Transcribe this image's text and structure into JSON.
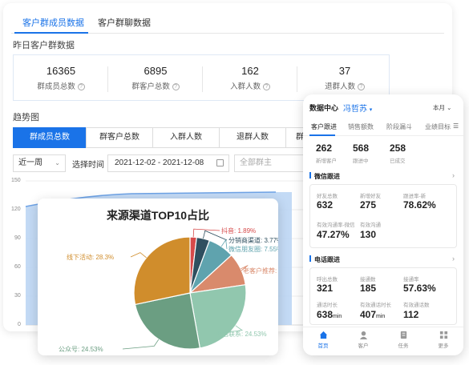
{
  "tabs": [
    "客户群成员数据",
    "客户群聊数据"
  ],
  "yesterday_title": "昨日客户群数据",
  "stats": [
    {
      "value": "16365",
      "label": "群成员总数"
    },
    {
      "value": "6895",
      "label": "群客户总数"
    },
    {
      "value": "162",
      "label": "入群人数"
    },
    {
      "value": "37",
      "label": "退群人数"
    }
  ],
  "trend_title": "趋势图",
  "metric_tabs": [
    "群成员总数",
    "群客户总数",
    "入群人数",
    "退群人数",
    "群"
  ],
  "filters": {
    "period": "近一周",
    "time_label": "选择时间",
    "date_range": "2021-12-02 - 2021-12-08",
    "owner_placeholder": "全部群主"
  },
  "trend_axis": {
    "y_ticks": [
      "150",
      "120",
      "90",
      "60",
      "30",
      "0"
    ]
  },
  "pie": {
    "title": "来源渠道TOP10占比",
    "chart_data": {
      "type": "pie",
      "slices": [
        {
          "label": "抖音",
          "value": 1.89,
          "text": "抖音: 1.89%",
          "color": "#d64a4a"
        },
        {
          "label": "分销商渠道",
          "value": 3.77,
          "text": "分销商渠道: 3.77%",
          "color": "#2f4f5f"
        },
        {
          "label": "微信朋友圈",
          "value": 7.55,
          "text": "微信朋友圈: 7.55%",
          "color": "#5fa3ae"
        },
        {
          "label": "老客户推荐",
          "value": 9.43,
          "text": "老客户推荐: 9.43%",
          "color": "#d98a6c"
        },
        {
          "label": "电话联系",
          "value": 24.53,
          "text": "电话联系: 24.53%",
          "color": "#91c7ae"
        },
        {
          "label": "公众号",
          "value": 24.53,
          "text": "公众号: 24.53%",
          "color": "#6b9e82"
        },
        {
          "label": "线下活动",
          "value": 28.3,
          "text": "线下活动: 28.3%",
          "color": "#d08d2c"
        }
      ]
    }
  },
  "mobile": {
    "title": "数据中心",
    "user": "冯哲苏",
    "period": "本月",
    "tabs": [
      "客户跟进",
      "销售额数",
      "阶段漏斗",
      "业绩目标"
    ],
    "top_stats": [
      {
        "value": "262",
        "label": "新增客户"
      },
      {
        "value": "568",
        "label": "跟进中"
      },
      {
        "value": "258",
        "label": "已成交"
      }
    ],
    "wechat_title": "微信跟进",
    "wechat_stats": [
      {
        "label": "好友总数",
        "value": "632",
        "unit": ""
      },
      {
        "label": "新增好友",
        "value": "275",
        "unit": ""
      },
      {
        "label": "跟进率-新",
        "value": "78.62%",
        "unit": ""
      },
      {
        "label": "有效沟通率-微信",
        "value": "47.27%",
        "unit": ""
      },
      {
        "label": "有效沟通",
        "value": "130",
        "unit": ""
      }
    ],
    "phone_title": "电话跟进",
    "phone_stats": [
      {
        "label": "呼出总数",
        "value": "321",
        "unit": ""
      },
      {
        "label": "接通数",
        "value": "185",
        "unit": ""
      },
      {
        "label": "接通率",
        "value": "57.63%",
        "unit": ""
      },
      {
        "label": "通话时长",
        "value": "638",
        "unit": "min"
      },
      {
        "label": "有效通话时长",
        "value": "407",
        "unit": "min"
      },
      {
        "label": "有效通话数",
        "value": "112",
        "unit": ""
      }
    ],
    "nav": [
      "首页",
      "客户",
      "任务",
      "更多"
    ]
  }
}
